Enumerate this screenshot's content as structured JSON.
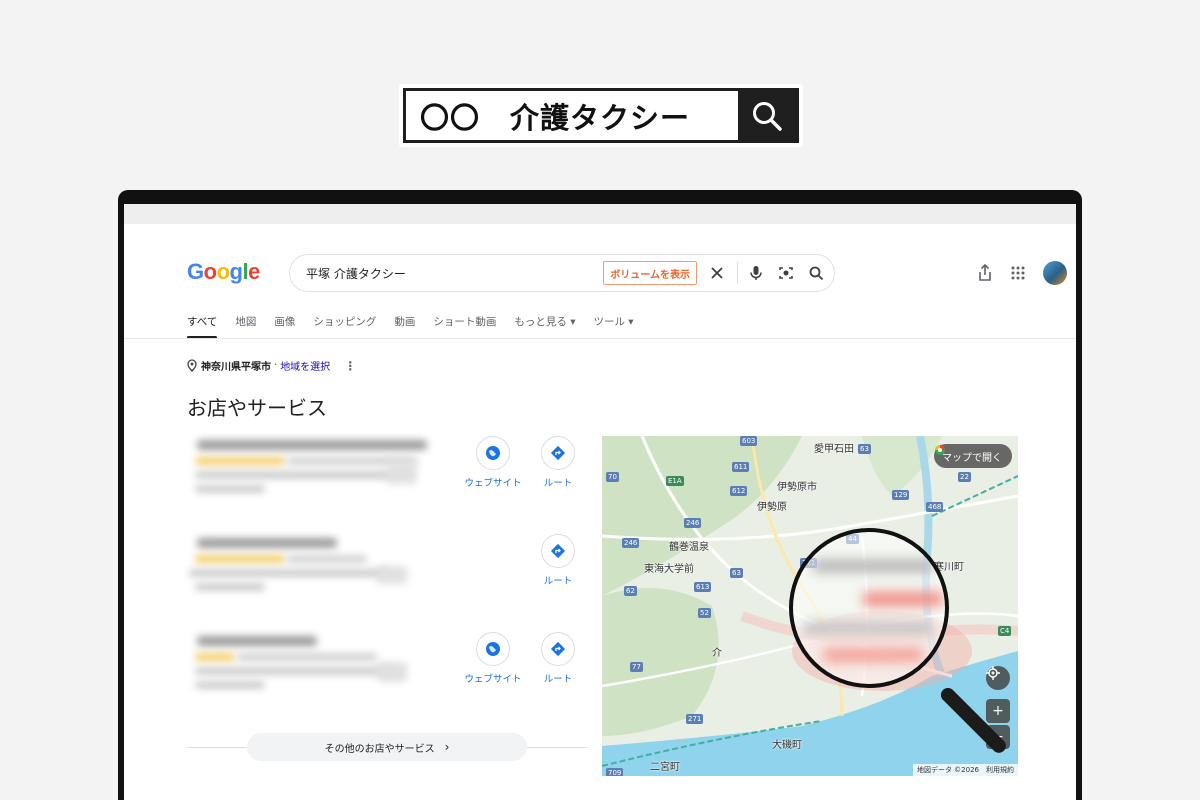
{
  "hero": {
    "query": "〇〇　介護タクシー"
  },
  "header": {
    "search_query": "平塚 介護タクシー",
    "volume_button": "ボリュームを表示"
  },
  "tabs": [
    {
      "label": "すべて",
      "active": true
    },
    {
      "label": "地図"
    },
    {
      "label": "画像"
    },
    {
      "label": "ショッピング"
    },
    {
      "label": "動画"
    },
    {
      "label": "ショート動画"
    },
    {
      "label": "もっと見る ▾"
    },
    {
      "label": "ツール ▾"
    }
  ],
  "location": {
    "name": "神奈川県平塚市",
    "separator": "·",
    "link": "地域を選択"
  },
  "section": {
    "title": "お店やサービス"
  },
  "listings": [
    {
      "actions": [
        "ウェブサイト",
        "ルート"
      ]
    },
    {
      "actions": [
        "ルート"
      ]
    },
    {
      "actions": [
        "ウェブサイト",
        "ルート"
      ]
    }
  ],
  "more_button": "その他のお店やサービス",
  "map": {
    "open_button": "マップで開く",
    "attribution": "地図データ ©2026　利用規約",
    "labels": [
      "愛甲石田",
      "伊勢原市",
      "伊勢原",
      "鶴巻温泉",
      "東海大学前",
      "寒川町",
      "介",
      "大磯町",
      "二宮町"
    ],
    "routes": [
      "603",
      "63",
      "70",
      "E1A",
      "611",
      "612",
      "246",
      "246",
      "63",
      "613",
      "271",
      "44",
      "62",
      "52",
      "77",
      "271",
      "129",
      "468",
      "22",
      "C4",
      "709"
    ],
    "zoom_in": "+",
    "zoom_out": "−"
  },
  "colors": {
    "google_blue": "#4285F4",
    "google_red": "#EA4335",
    "google_yellow": "#FBBC05",
    "google_green": "#34A853",
    "link": "#1a0dab",
    "action_blue": "#1a73e8",
    "volume_orange": "#e8662c"
  }
}
